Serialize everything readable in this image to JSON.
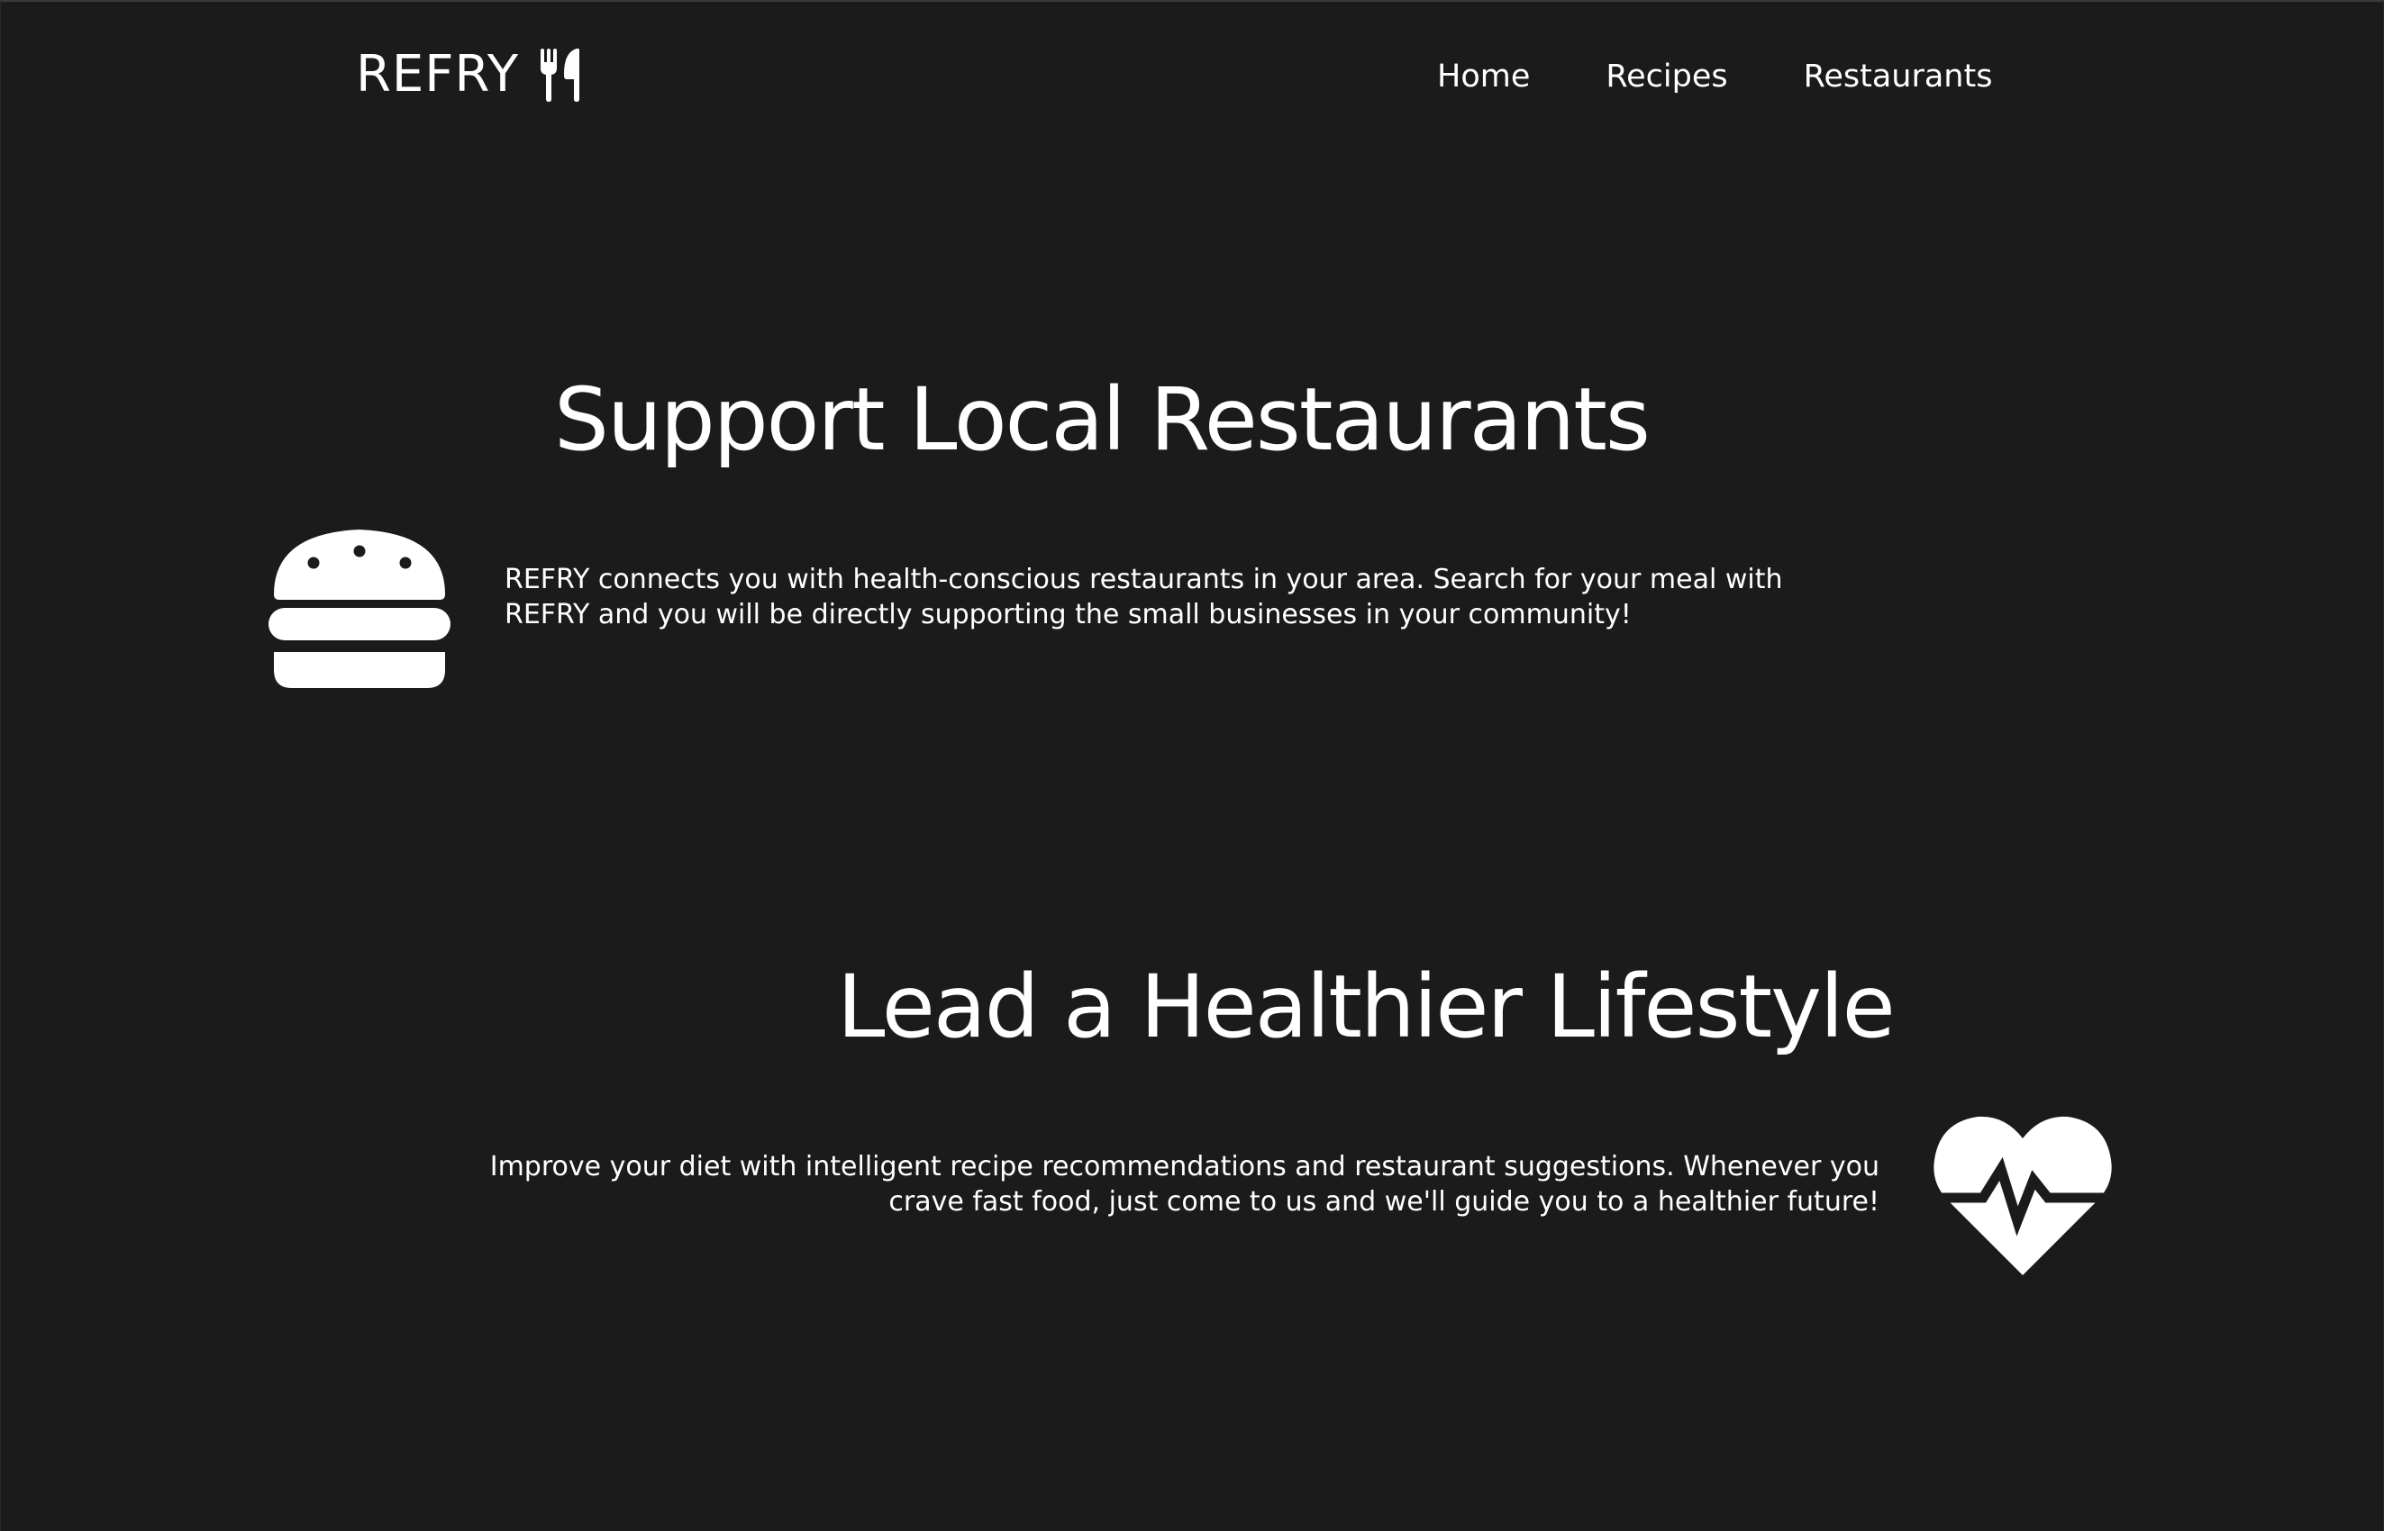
{
  "header": {
    "brand": "REFRY",
    "brand_icon": "utensils-icon",
    "nav": [
      {
        "label": "Home"
      },
      {
        "label": "Recipes"
      },
      {
        "label": "Restaurants"
      }
    ]
  },
  "sections": [
    {
      "title": "Support Local Restaurants",
      "text": "REFRY connects you with health-conscious restaurants in your area. Search for your meal with REFRY and you will be directly supporting the small businesses in your community!",
      "icon": "burger-icon"
    },
    {
      "title": "Lead a Healthier Lifestyle",
      "text": "Improve your diet with intelligent recipe recommendations and restaurant suggestions. Whenever you crave fast food, just come to us and we'll guide you to a healthier future!",
      "icon": "heart-pulse-icon"
    }
  ],
  "colors": {
    "background": "#1b1b1b",
    "text": "#ffffff"
  }
}
